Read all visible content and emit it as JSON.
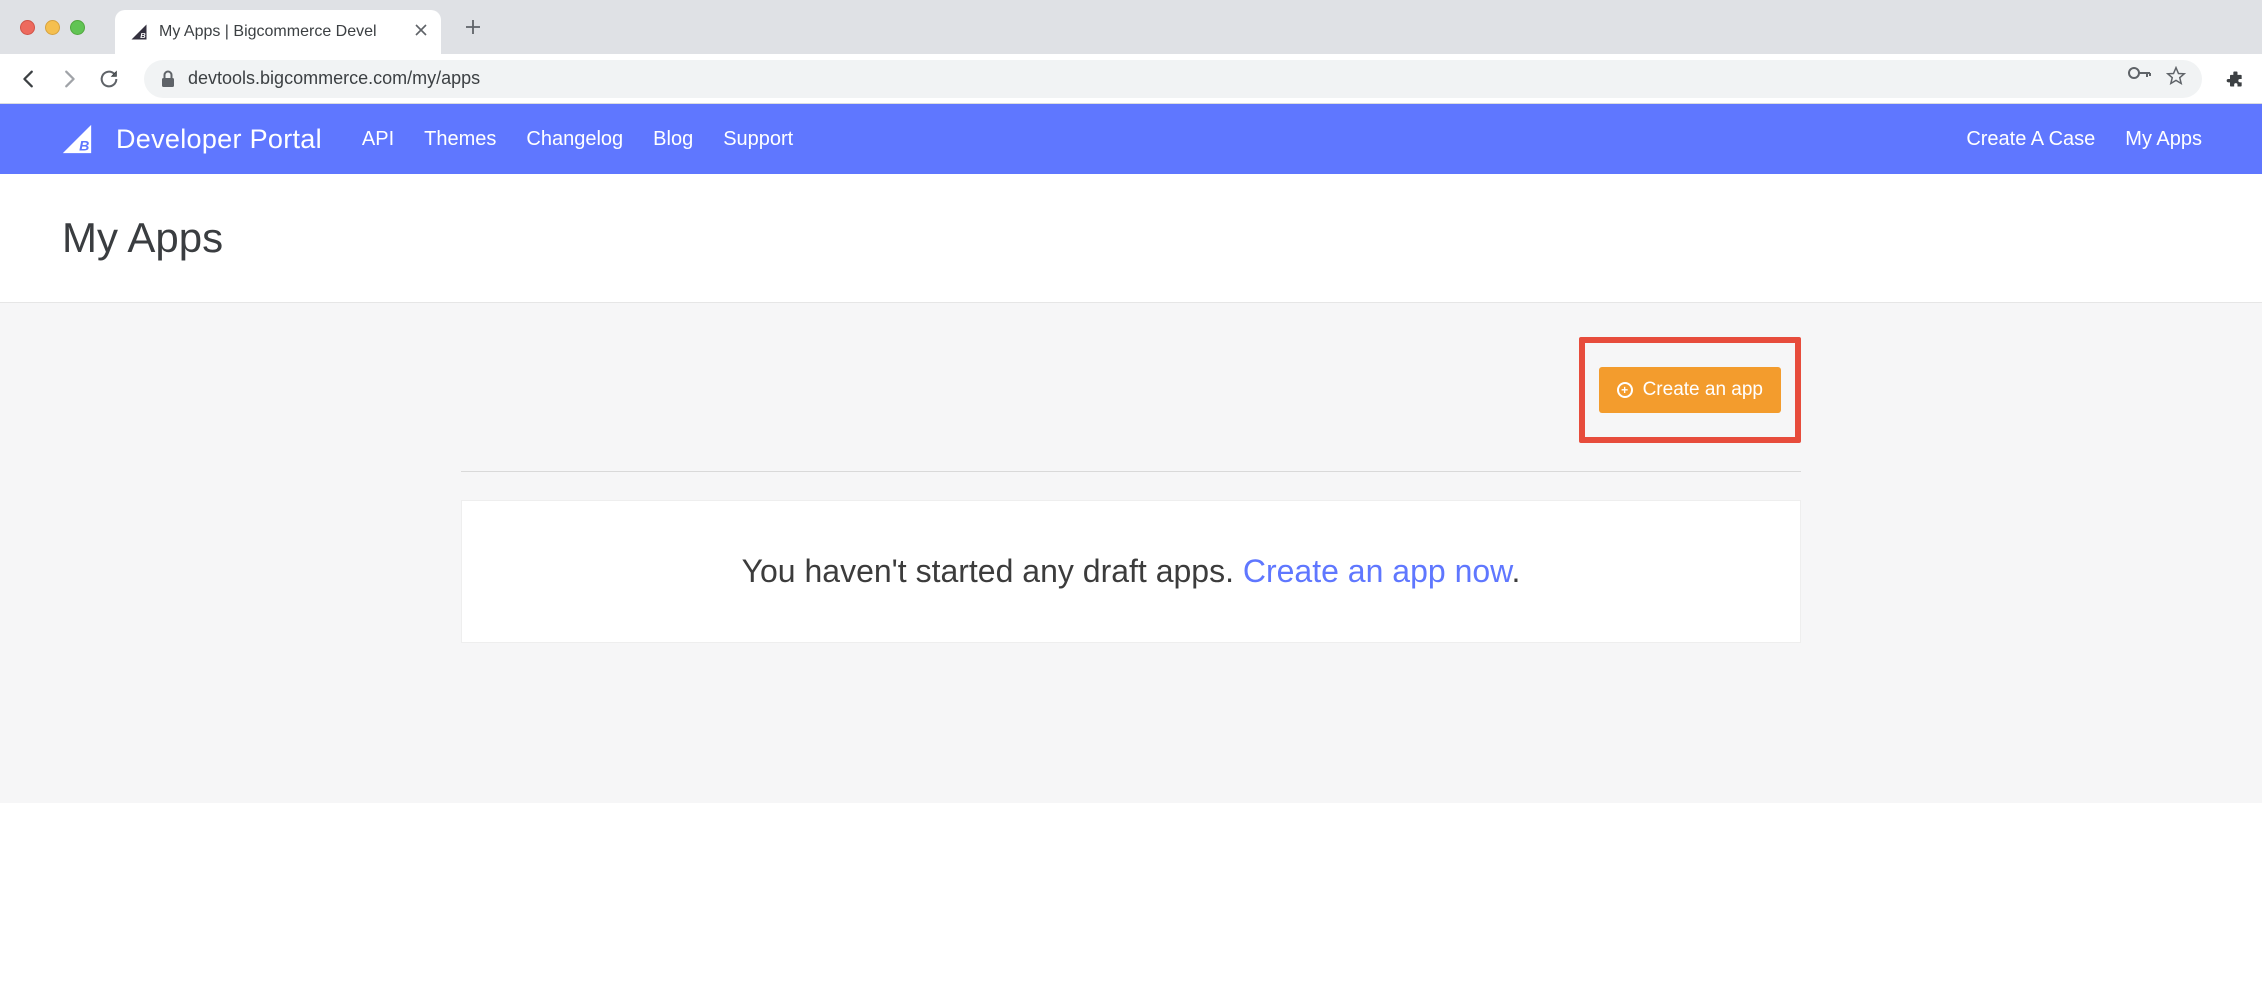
{
  "browser": {
    "tab_title": "My Apps | Bigcommerce Devel",
    "url": "devtools.bigcommerce.com/my/apps"
  },
  "nav": {
    "brand": "Developer Portal",
    "links": [
      "API",
      "Themes",
      "Changelog",
      "Blog",
      "Support"
    ],
    "right_links": [
      "Create A Case",
      "My Apps"
    ]
  },
  "page": {
    "title": "My Apps",
    "create_button": "Create an app",
    "empty_text": "You haven't started any draft apps. ",
    "empty_link_text": "Create an app now",
    "empty_period": "."
  }
}
